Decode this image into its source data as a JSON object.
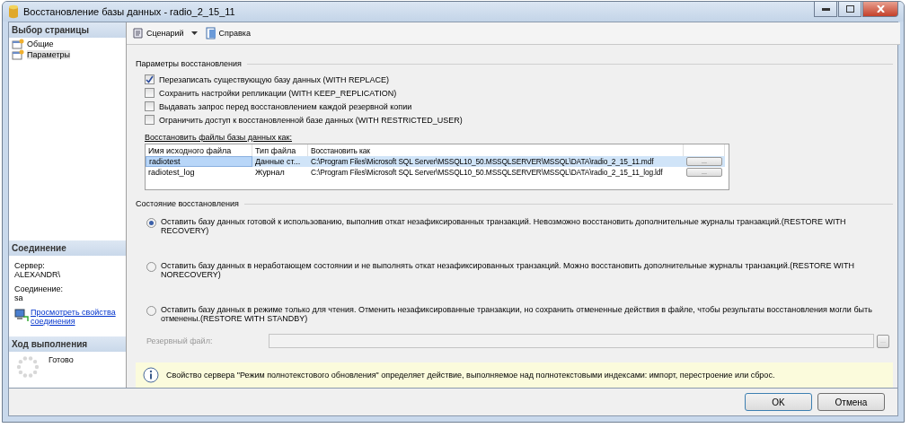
{
  "window": {
    "title": "Восстановление базы данных - radio_2_15_11"
  },
  "sidebar": {
    "pages_header": "Выбор страницы",
    "pages": [
      {
        "label": "Общие",
        "selected": false
      },
      {
        "label": "Параметры",
        "selected": true
      }
    ],
    "connection_header": "Соединение",
    "connection": [
      {
        "label": "Сервер:",
        "value": "ALEXANDR\\"
      },
      {
        "label": "Соединение:",
        "value": "sa"
      }
    ],
    "connection_link": "Просмотреть свойства соединения",
    "progress_header": "Ход выполнения",
    "progress_status": "Готово"
  },
  "toolbar": {
    "script": "Сценарий",
    "help": "Справка"
  },
  "restore_options": {
    "title": "Параметры восстановления",
    "options": [
      {
        "label": "Перезаписать существующую базу данных (WITH REPLACE)",
        "checked": true
      },
      {
        "label": "Сохранить настройки репликации (WITH KEEP_REPLICATION)",
        "checked": false
      },
      {
        "label": "Выдавать запрос перед восстановлением каждой резервной копии",
        "checked": false
      },
      {
        "label": "Ограничить доступ к восстановленной базе данных (WITH RESTRICTED_USER)",
        "checked": false
      }
    ]
  },
  "files": {
    "label": "Восстановить файлы базы данных как:",
    "columns": [
      "Имя исходного файла",
      "Тип файла",
      "Восстановить как"
    ],
    "rows": [
      {
        "name": "radiotest",
        "type": "Данные ст...",
        "path": "C:\\Program Files\\Microsoft SQL Server\\MSSQL10_50.MSSQLSERVER\\MSSQL\\DATA\\radio_2_15_11.mdf",
        "button": "...",
        "selected": true
      },
      {
        "name": "radiotest_log",
        "type": "Журнал",
        "path": "C:\\Program Files\\Microsoft SQL Server\\MSSQL10_50.MSSQLSERVER\\MSSQL\\DATA\\radio_2_15_11_log.ldf",
        "button": "...",
        "selected": false
      }
    ]
  },
  "recovery_state": {
    "title": "Состояние восстановления",
    "options": [
      {
        "label": "Оставить базу данных готовой к использованию, выполнив откат незафиксированных транзакций. Невозможно восстановить дополнительные журналы транзакций.(RESTORE WITH RECOVERY)",
        "selected": true
      },
      {
        "label": "Оставить базу данных в неработающем состоянии и не выполнять откат незафиксированных транзакций. Можно восстановить дополнительные журналы транзакций.(RESTORE WITH NORECOVERY)",
        "selected": false
      },
      {
        "label": "Оставить базу данных в режиме только для чтения. Отменить незафиксированные транзакции, но сохранить отмененные действия в файле, чтобы результаты восстановления могли быть отменены.(RESTORE WITH STANDBY)",
        "selected": false
      }
    ],
    "standby_file_label": "Резервный файл:",
    "standby_file_disabled": true,
    "standby_button": "..."
  },
  "info": "Свойство сервера \"Режим полнотекстового обновления\" определяет действие, выполняемое над полнотекстовыми индексами: импорт, перестроение или сброс.",
  "buttons": [
    "OK",
    "Отмена"
  ]
}
